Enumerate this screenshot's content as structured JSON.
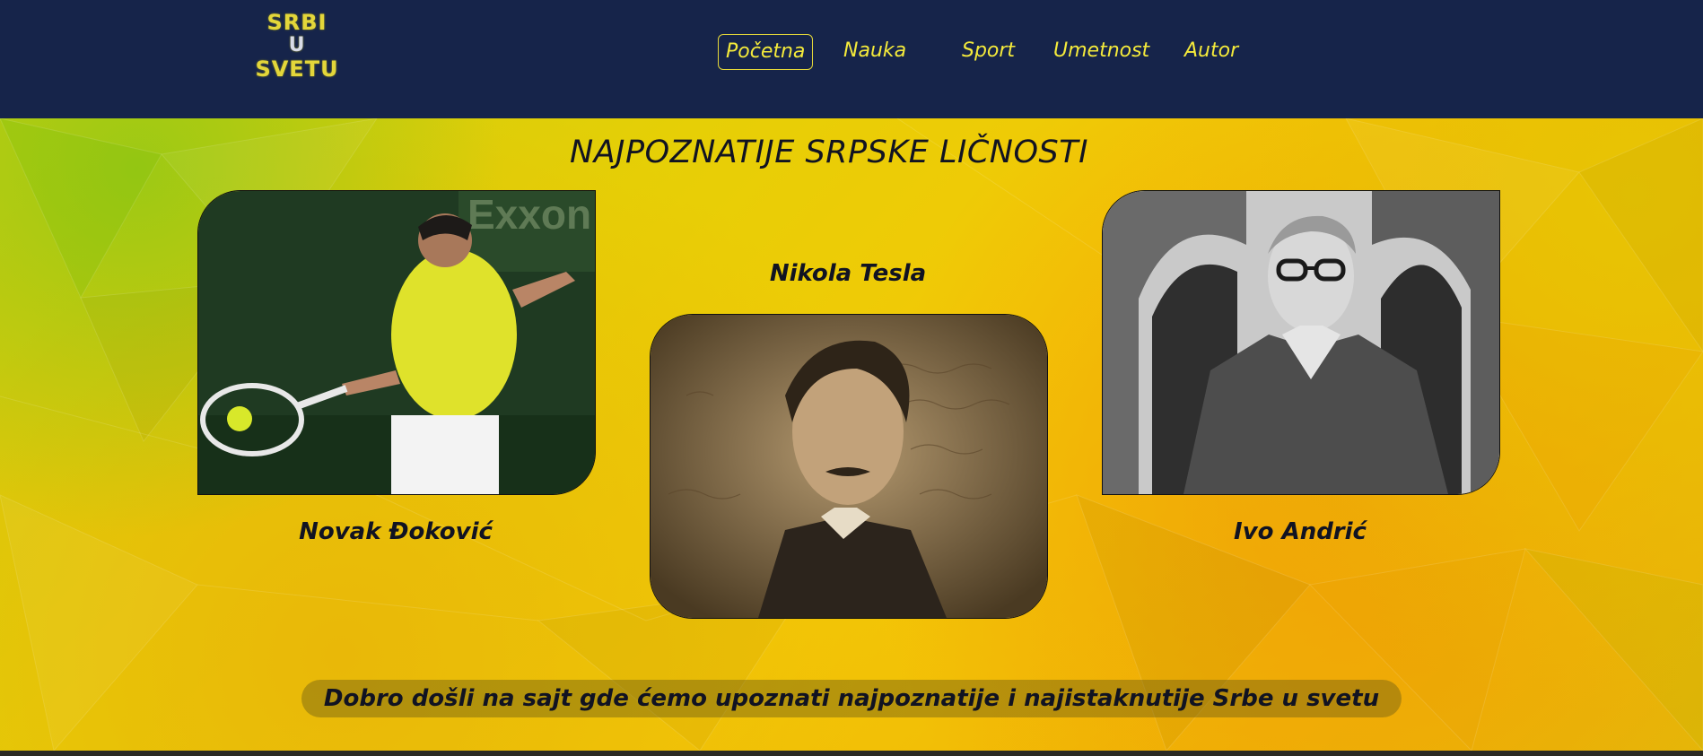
{
  "logo": {
    "line1": "SRBI",
    "line2": "U",
    "line3": "SVETU"
  },
  "nav": {
    "items": [
      {
        "label": "Početna",
        "active": true
      },
      {
        "label": "Nauka",
        "active": false
      },
      {
        "label": "Sport",
        "active": false
      },
      {
        "label": "Umetnost",
        "active": false
      },
      {
        "label": "Autor",
        "active": false
      }
    ]
  },
  "main": {
    "title": "NAJPOZNATIJE SRPSKE LIČNOSTI",
    "people": [
      {
        "name": "Novak Đoković"
      },
      {
        "name": "Nikola Tesla"
      },
      {
        "name": "Ivo Andrić"
      }
    ],
    "welcome": "Dobro došli na sajt gde ćemo upoznati najpoznatije i najistaknutije Srbe u svetu"
  },
  "colors": {
    "header_bg": "#16244a",
    "nav_text": "#f4ea3b",
    "title_text": "#111322",
    "background_yellow": "#f4c806"
  }
}
